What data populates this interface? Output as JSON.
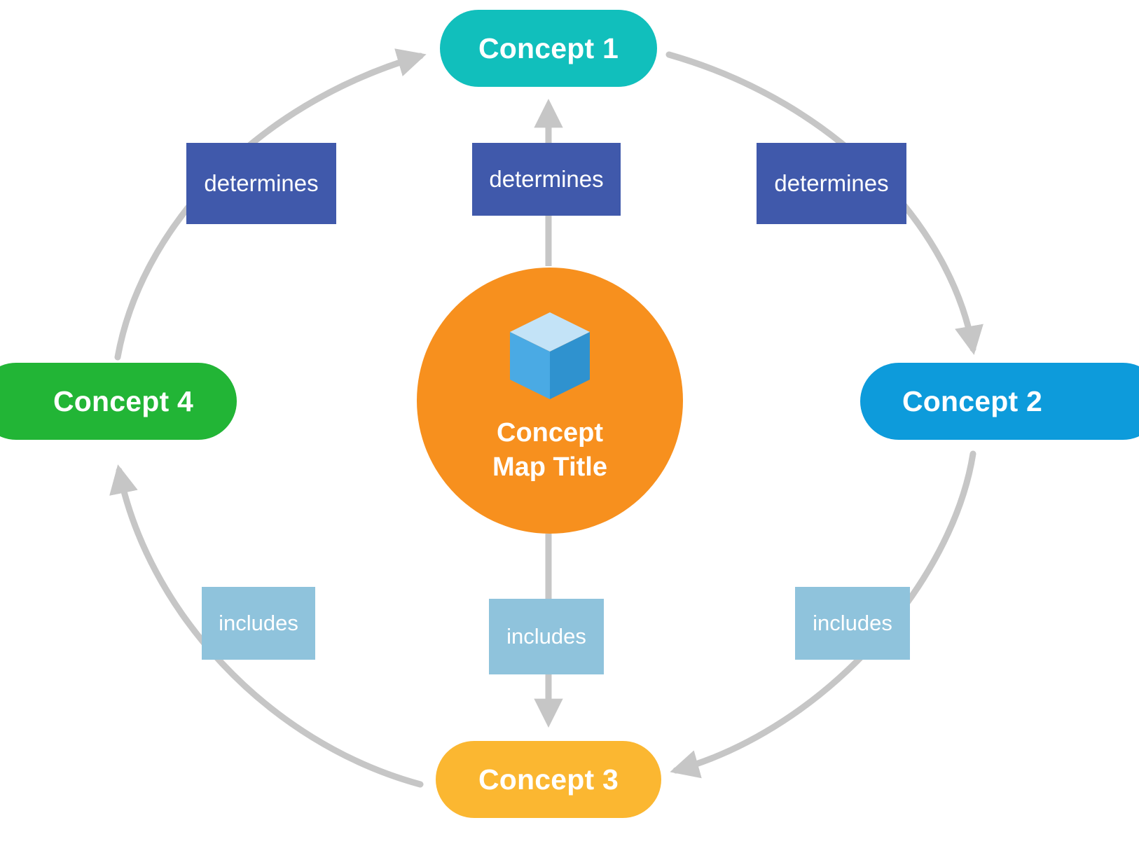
{
  "diagram": {
    "type": "concept-map",
    "background": "#ffffff",
    "center": {
      "title": "Concept\nMap Title",
      "icon": "cube-icon",
      "color": "#f7901e",
      "text_color": "#ffffff"
    },
    "nodes": [
      {
        "id": "concept1",
        "label": "Concept 1",
        "color": "#11bfbc",
        "position": "top"
      },
      {
        "id": "concept2",
        "label": "Concept 2",
        "color": "#0d9bdb",
        "position": "right"
      },
      {
        "id": "concept3",
        "label": "Concept 3",
        "color": "#fbb731",
        "position": "bottom"
      },
      {
        "id": "concept4",
        "label": "Concept 4",
        "color": "#22b536",
        "position": "left"
      }
    ],
    "relation_labels": [
      {
        "id": "determines-left",
        "text": "determines",
        "color": "#4059ab",
        "edge": "concept4-to-concept1"
      },
      {
        "id": "determines-mid",
        "text": "determines",
        "color": "#4059ab",
        "edge": "center-to-concept1"
      },
      {
        "id": "determines-right",
        "text": "determines",
        "color": "#4059ab",
        "edge": "concept1-to-concept2"
      },
      {
        "id": "includes-left",
        "text": "includes",
        "color": "#8fc3dc",
        "edge": "concept3-to-concept4"
      },
      {
        "id": "includes-mid",
        "text": "includes",
        "color": "#8fc3dc",
        "edge": "center-to-concept3"
      },
      {
        "id": "includes-right",
        "text": "includes",
        "color": "#8fc3dc",
        "edge": "concept2-to-concept3"
      }
    ],
    "edges": [
      {
        "id": "concept4-to-concept1",
        "from": "concept4",
        "to": "concept1",
        "style": "curved",
        "label": "determines",
        "color": "#c6c6c6"
      },
      {
        "id": "center-to-concept1",
        "from": "center",
        "to": "concept1",
        "style": "straight",
        "label": "determines",
        "color": "#c6c6c6"
      },
      {
        "id": "concept1-to-concept2",
        "from": "concept1",
        "to": "concept2",
        "style": "curved",
        "label": "determines",
        "color": "#c6c6c6"
      },
      {
        "id": "concept2-to-concept3",
        "from": "concept2",
        "to": "concept3",
        "style": "curved",
        "label": "includes",
        "color": "#c6c6c6"
      },
      {
        "id": "center-to-concept3",
        "from": "center",
        "to": "concept3",
        "style": "straight",
        "label": "includes",
        "color": "#c6c6c6"
      },
      {
        "id": "concept3-to-concept4",
        "from": "concept3",
        "to": "concept4",
        "style": "curved",
        "label": "includes",
        "color": "#c6c6c6"
      }
    ],
    "colors": {
      "arrow": "#c6c6c6",
      "cube_top": "#c3e3f7",
      "cube_left": "#4aaae4",
      "cube_right": "#2f92cf"
    }
  }
}
